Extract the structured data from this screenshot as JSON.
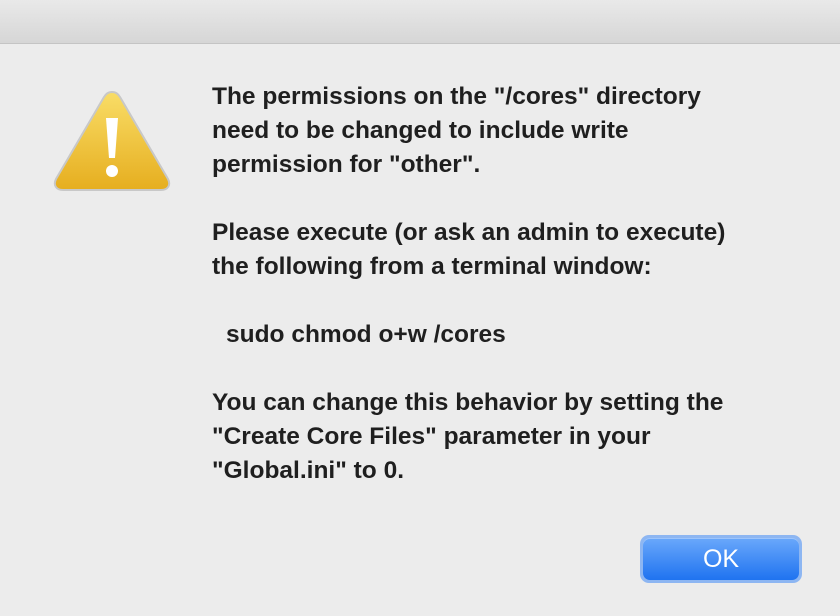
{
  "dialog": {
    "icon": "warning-triangle-icon",
    "paragraphs": [
      "The permissions on the \"/cores\" directory\nneed to be changed to include write\npermission for \"other\".",
      "Please execute (or ask an admin to execute)\nthe following from a terminal window:",
      "sudo chmod o+w /cores",
      "You can change this behavior by setting the\n\"Create Core Files\" parameter in your\n\"Global.ini\" to 0."
    ],
    "ok_label": "OK"
  },
  "colors": {
    "background": "#ececec",
    "button_accent": "#1f73f0",
    "warning_yellow": "#f2c230"
  }
}
